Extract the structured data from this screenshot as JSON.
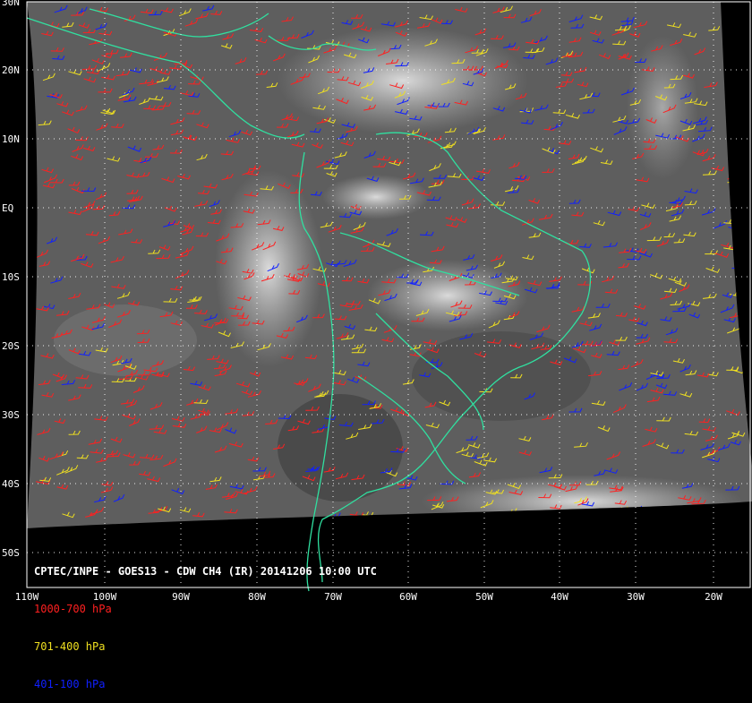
{
  "title": "CPTEC/INPE - GOES13 - CDW CH4 (IR) 20141206 10:00 UTC",
  "legend": [
    {
      "label": "1000-700 hPa",
      "color": "#ff2020"
    },
    {
      "label": "701-400 hPa",
      "color": "#f0e020"
    },
    {
      "label": "401-100 hPa",
      "color": "#1020ff"
    }
  ],
  "lat_labels": [
    "30N",
    "20N",
    "10N",
    "EQ",
    "10S",
    "20S",
    "30S",
    "40S",
    "50S"
  ],
  "lon_labels": [
    "110W",
    "100W",
    "90W",
    "80W",
    "70W",
    "60W",
    "50W",
    "40W",
    "30W",
    "20W"
  ],
  "colors": {
    "background": "#000000",
    "coastline": "#30e0a0",
    "grid": "#ffffff",
    "imagery_gray": "#6a6a6a"
  }
}
